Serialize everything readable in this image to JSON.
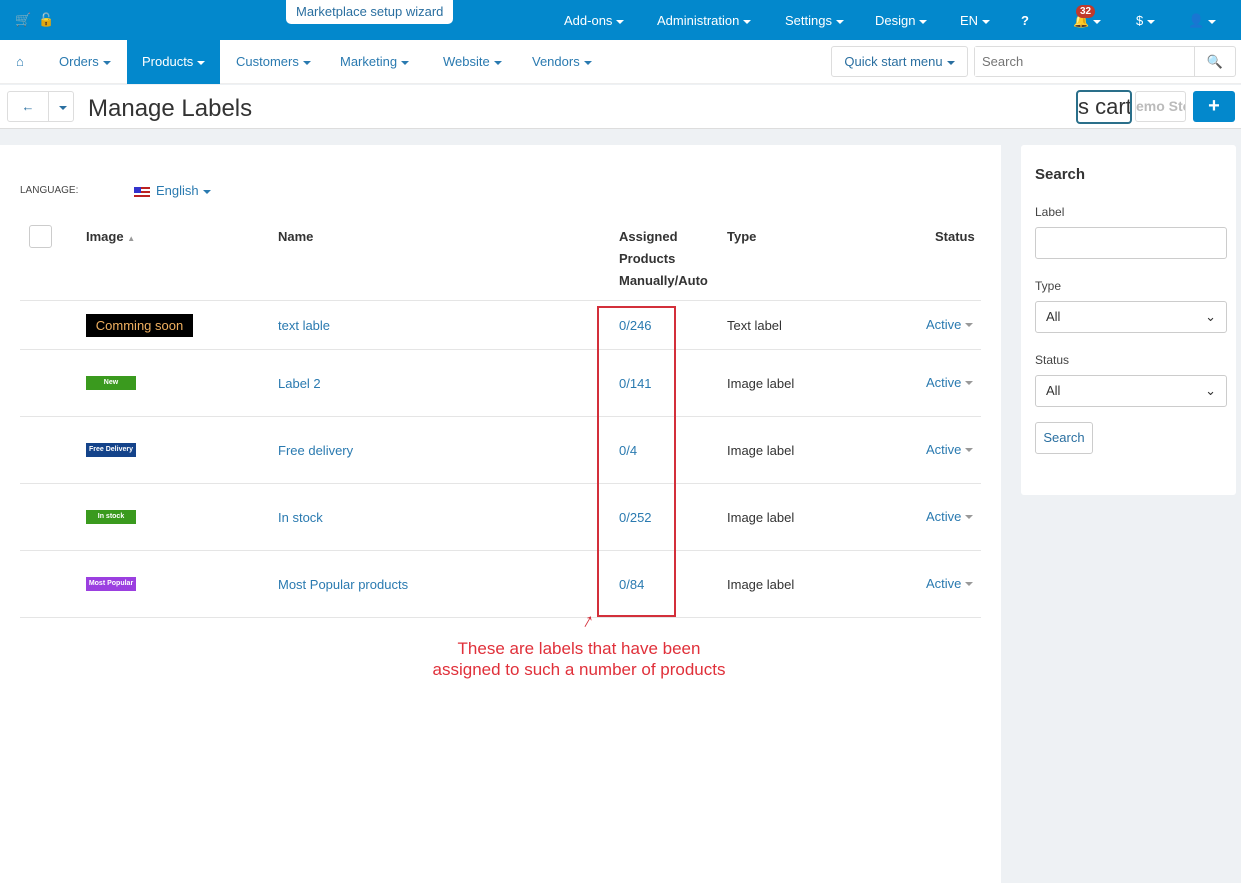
{
  "topbar": {
    "wizard": "Marketplace setup wizard",
    "items": [
      "Add-ons",
      "Administration",
      "Settings",
      "Design",
      "EN"
    ],
    "notifications": "32",
    "currency": "$"
  },
  "nav": {
    "items": [
      "Orders",
      "Products",
      "Customers",
      "Marketing",
      "Website",
      "Vendors"
    ],
    "quick_start": "Quick start menu",
    "search_placeholder": "Search"
  },
  "header": {
    "title": "Manage Labels",
    "cart_text": "s cart",
    "demo_text": "emo Sto"
  },
  "main": {
    "language_label": "LANGUAGE:",
    "language": "English",
    "columns": {
      "image": "Image",
      "name": "Name",
      "assigned": "Assigned Products Manually/Auto",
      "type": "Type",
      "status": "Status"
    },
    "rows": [
      {
        "image_text": "Comming soon",
        "name": "text lable",
        "assigned": "0/246",
        "type": "Text label",
        "status": "Active",
        "color": "#000000"
      },
      {
        "image_text": "New",
        "name": "Label 2",
        "assigned": "0/141",
        "type": "Image label",
        "status": "Active",
        "color": "#3a9a1e"
      },
      {
        "image_text": "Free Delivery",
        "name": "Free delivery",
        "assigned": "0/4",
        "type": "Image label",
        "status": "Active",
        "color": "#14438a"
      },
      {
        "image_text": "In stock",
        "name": "In stock",
        "assigned": "0/252",
        "type": "Image label",
        "status": "Active",
        "color": "#3a9a1e"
      },
      {
        "image_text": "Most Popular",
        "name": "Most Popular products",
        "assigned": "0/84",
        "type": "Image label",
        "status": "Active",
        "color": "#9b3fe0"
      }
    ],
    "annotation": "These are labels that have been assigned to such a number of products"
  },
  "sidebar": {
    "title": "Search",
    "label_label": "Label",
    "type_label": "Type",
    "type_value": "All",
    "status_label": "Status",
    "status_value": "All",
    "search_button": "Search"
  }
}
